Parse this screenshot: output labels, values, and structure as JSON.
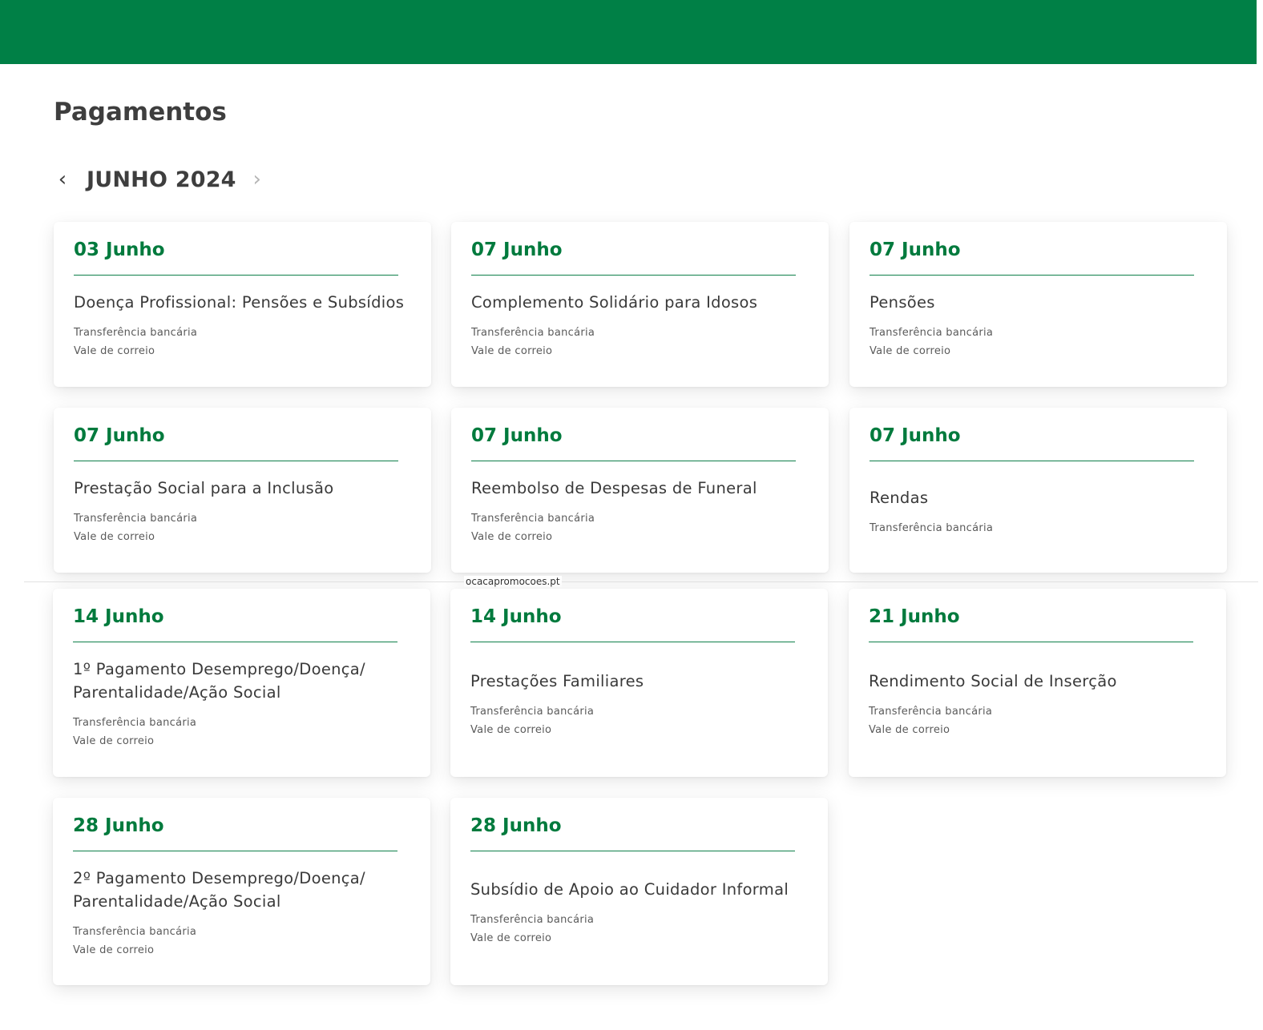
{
  "page": {
    "title": "Pagamentos",
    "month_label": "JUNHO 2024",
    "prev_icon": "‹",
    "next_icon": "›"
  },
  "colors": {
    "header_green": "#008046",
    "accent_green": "#007a3d",
    "text_dark": "#3e3e3e"
  },
  "watermark": "ocacapromocoes.pt",
  "payments": [
    {
      "date": "03 Junho",
      "title": "Doença Profissional: Pensões e Subsídios",
      "methods": [
        "Transferência bancária",
        "Vale de correio"
      ]
    },
    {
      "date": "07 Junho",
      "title": "Complemento Solidário para Idosos",
      "methods": [
        "Transferência bancária",
        "Vale de correio"
      ]
    },
    {
      "date": "07 Junho",
      "title": "Pensões",
      "methods": [
        "Transferência bancária",
        "Vale de correio"
      ]
    },
    {
      "date": "07 Junho",
      "title": "Prestação Social para a Inclusão",
      "methods": [
        "Transferência bancária",
        "Vale de correio"
      ]
    },
    {
      "date": "07 Junho",
      "title": "Reembolso de Despesas de Funeral",
      "methods": [
        "Transferência bancária",
        "Vale de correio"
      ]
    },
    {
      "date": "07 Junho",
      "title": "Rendas",
      "methods": [
        "Transferência bancária"
      ]
    },
    {
      "date": "14 Junho",
      "title": "1º Pagamento Desemprego/Doença/ Parentalidade/Ação Social",
      "methods": [
        "Transferência bancária",
        "Vale de correio"
      ]
    },
    {
      "date": "14 Junho",
      "title": "Prestações Familiares",
      "methods": [
        "Transferência bancária",
        "Vale de correio"
      ]
    },
    {
      "date": "21 Junho",
      "title": "Rendimento Social de Inserção",
      "methods": [
        "Transferência bancária",
        "Vale de correio"
      ]
    },
    {
      "date": "28 Junho",
      "title": "2º Pagamento Desemprego/Doença/ Parentalidade/Ação Social",
      "methods": [
        "Transferência bancária",
        "Vale de correio"
      ]
    },
    {
      "date": "28 Junho",
      "title": "Subsídio de Apoio ao Cuidador Informal",
      "methods": [
        "Transferência bancária",
        "Vale de correio"
      ]
    }
  ]
}
